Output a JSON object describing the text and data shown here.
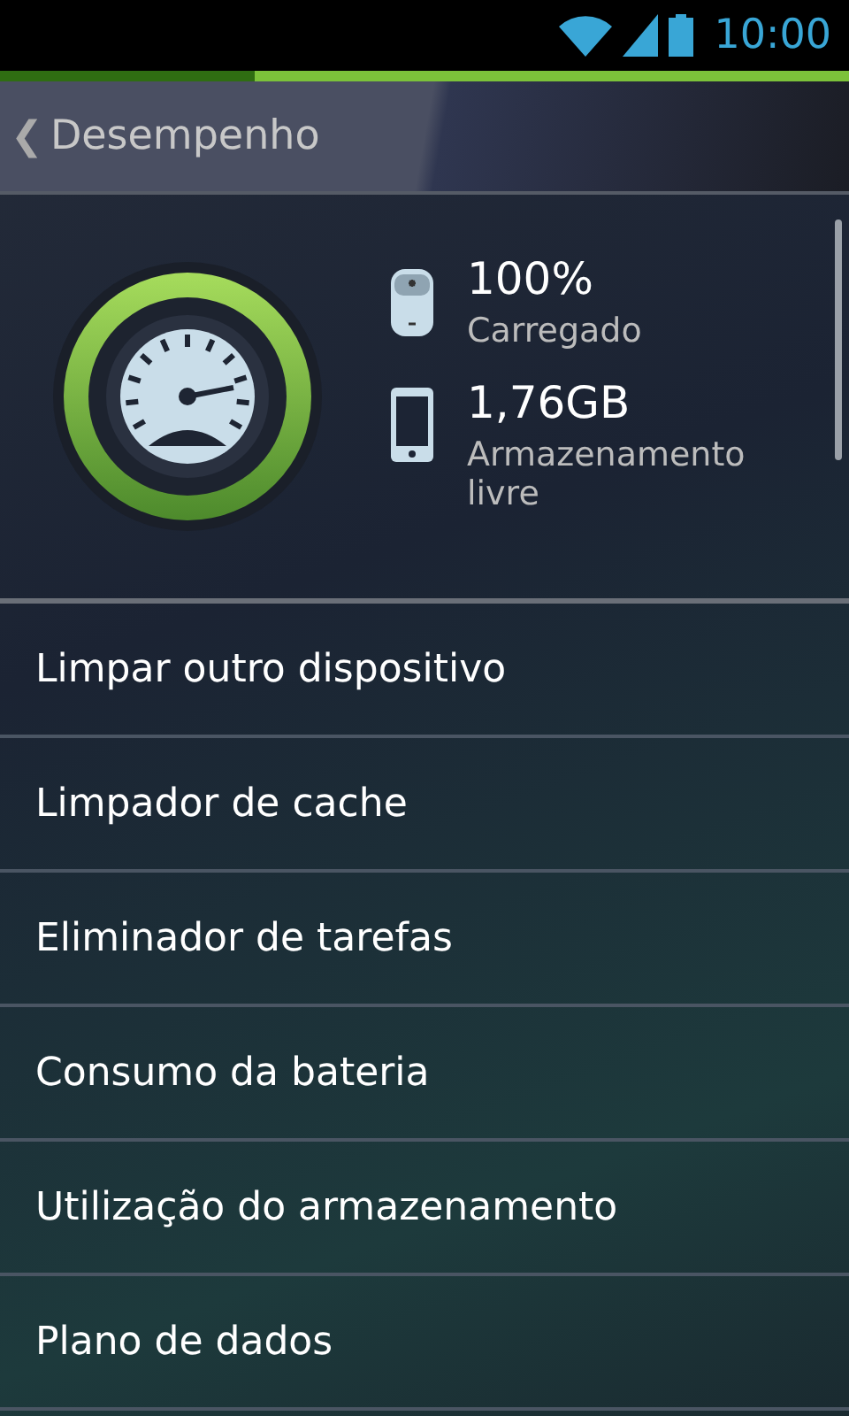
{
  "status_bar": {
    "time": "10:00"
  },
  "header": {
    "back": "❮",
    "title": "Desempenho"
  },
  "stats": [
    {
      "kind": "battery",
      "value": "100%",
      "label": "Carregado"
    },
    {
      "kind": "phone",
      "value": "1,76GB",
      "label": "Armazenamento livre"
    }
  ],
  "menu": [
    "Limpar outro dispositivo",
    "Limpador de cache",
    "Eliminador de tarefas",
    "Consumo da bateria",
    "Utilização do armazenamento",
    "Plano de dados"
  ]
}
